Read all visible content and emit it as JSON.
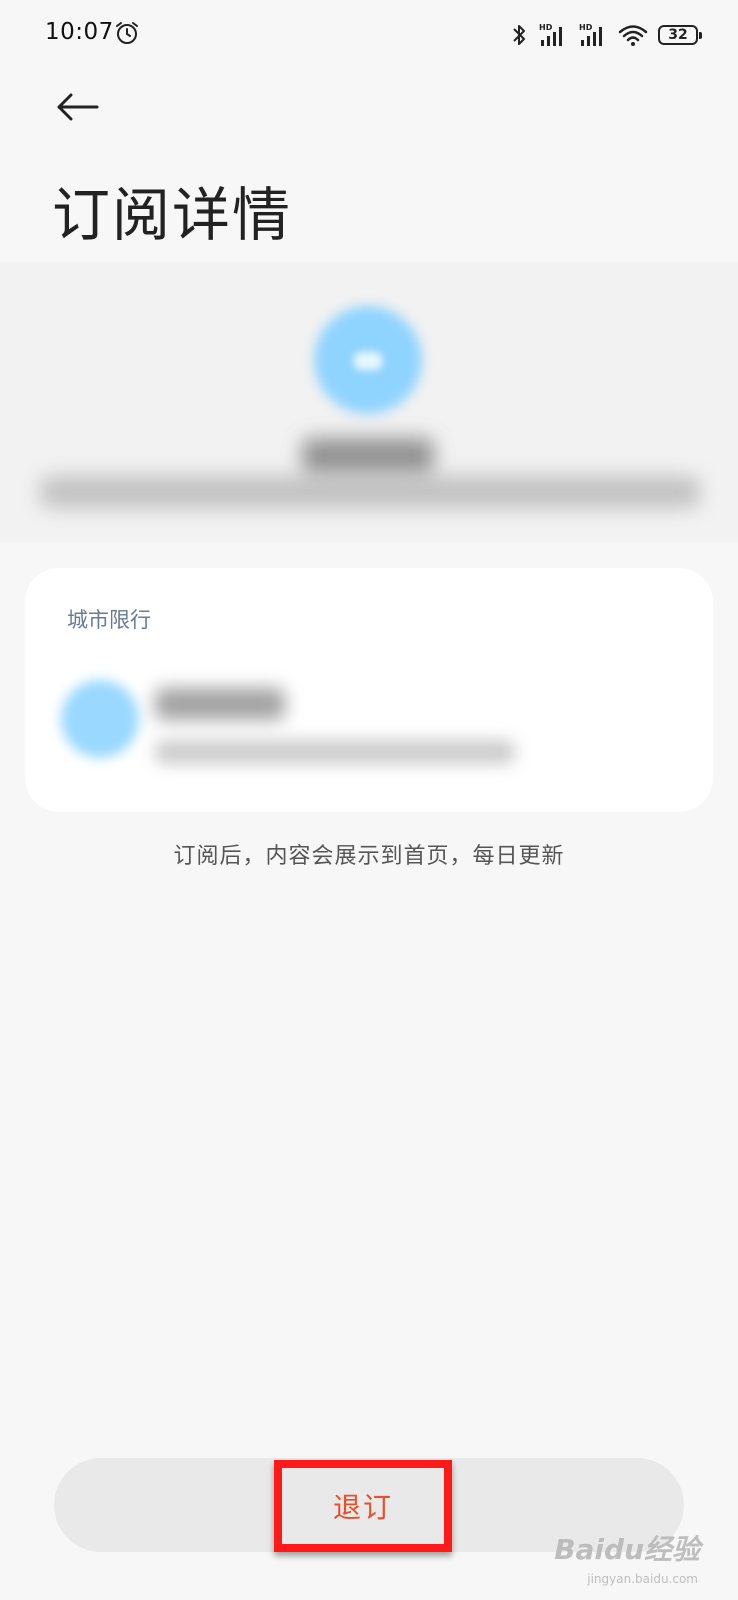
{
  "status_bar": {
    "time": "10:07",
    "battery": "32",
    "icons": [
      "alarm-icon",
      "bluetooth-icon",
      "signal-hd-1-icon",
      "signal-hd-2-icon",
      "wifi-icon",
      "battery-icon"
    ]
  },
  "header": {
    "title": "订阅详情"
  },
  "card": {
    "title": "城市限行"
  },
  "hint": "订阅后，内容会展示到首页，每日更新",
  "footer": {
    "unsubscribe_label": "退订"
  },
  "watermark": {
    "text": "Baidu经验",
    "sub": "jingyan.baidu.com"
  },
  "colors": {
    "accent_red": "#e8502a",
    "highlight_red": "#ff1a1a",
    "card_title": "#6b7a96",
    "blur_blue": "#8fd3ff"
  }
}
